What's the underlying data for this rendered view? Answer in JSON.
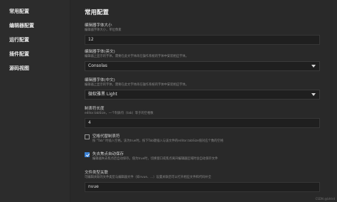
{
  "sidebar": {
    "items": [
      {
        "label": "常用配置"
      },
      {
        "label": "编辑器配置"
      },
      {
        "label": "运行配置"
      },
      {
        "label": "插件配置"
      },
      {
        "label": "源码视图"
      }
    ]
  },
  "main": {
    "title": "常用配置",
    "font_size": {
      "label": "编辑器字体大小",
      "hint": "编辑器字体大小，单位像素",
      "value": "12"
    },
    "font_en": {
      "label": "编辑器字体(英文)",
      "hint": "编辑器上显示的字体，需要在此文字体再在操作系统的字体中安装相应字体。",
      "value": "Consolas"
    },
    "font_cn": {
      "label": "编辑器字体(中文)",
      "hint": "编辑器上显示的字体，需要在此文字体再在操作系统的字体中安装相应字体。",
      "value": "微软雅黑 Light"
    },
    "tab_size": {
      "label": "制表符长度",
      "hint": "editor.tabSize，一个制表符（tab）等于的空格数",
      "value": "4"
    },
    "indent_tab": {
      "label": "空格代替制表符",
      "hint": "按 \"Tab\" 时插入空格。该为true时，按下Tab键插入与该文件的editor.tabSize值对应个数的空格",
      "checked": false
    },
    "autosave": {
      "label": "失去焦点自动保存",
      "hint": "编辑器失去焦点后自动保存。值为true时，切换窗口或焦点离开编辑器区域时会自动保存文件",
      "checked": true
    },
    "file_assoc": {
      "label": "文件类型关联",
      "hint": "可编辑关联的文件类型与编辑器文件（如nvue、...）设置关联后可以打开相应文件和代码补全",
      "value": "nvue"
    },
    "watermark": "CSDN @bhtrd"
  },
  "colors": {
    "accent": "#3b82d6",
    "background": "#292929",
    "sidebar": "#2c2c2c"
  }
}
